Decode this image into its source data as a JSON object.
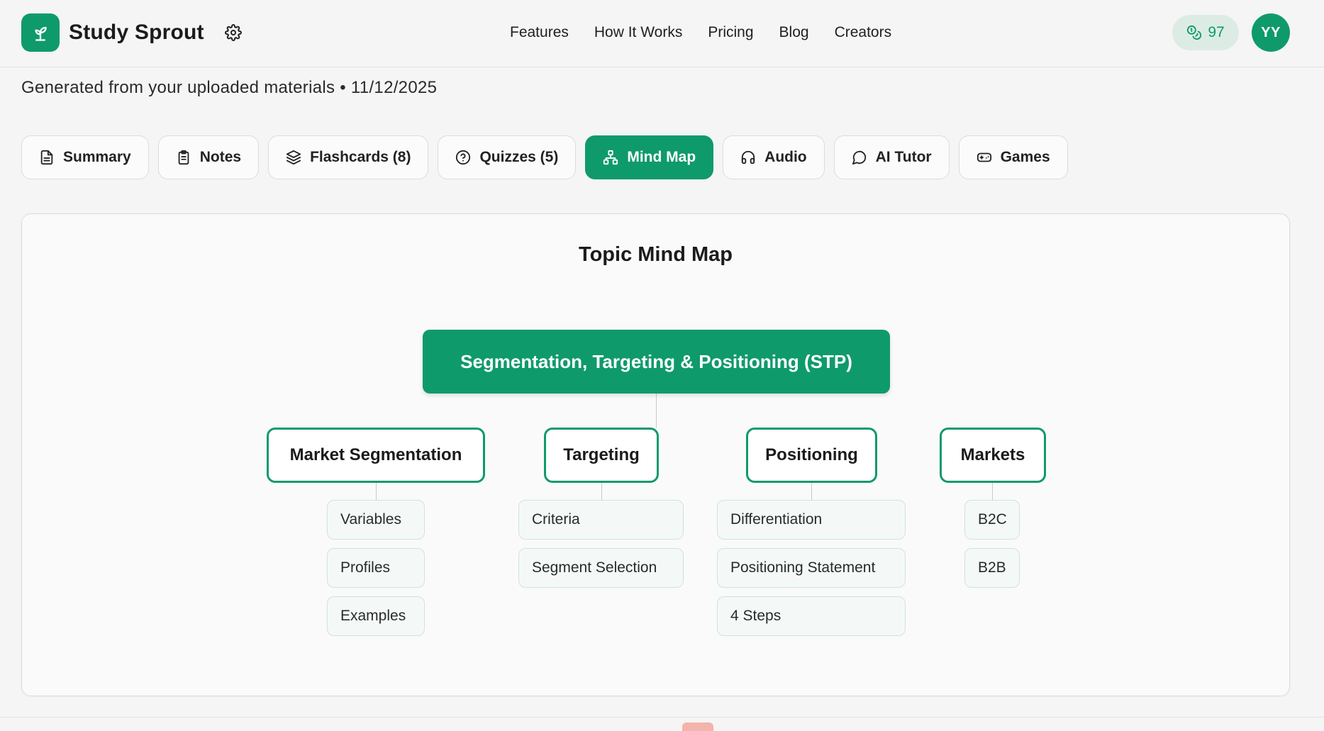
{
  "header": {
    "brand_name": "Study Sprout",
    "logo_icon": "sprout-icon",
    "nav": [
      "Features",
      "How It Works",
      "Pricing",
      "Blog",
      "Creators"
    ],
    "credits": "97",
    "avatar_initials": "YY"
  },
  "subtitle": "Generated from your uploaded materials • 11/12/2025",
  "tabs": [
    {
      "label": "Summary",
      "icon": "document-icon",
      "active": false
    },
    {
      "label": "Notes",
      "icon": "clipboard-icon",
      "active": false
    },
    {
      "label": "Flashcards (8)",
      "icon": "layers-icon",
      "active": false
    },
    {
      "label": "Quizzes (5)",
      "icon": "help-circle-icon",
      "active": false
    },
    {
      "label": "Mind Map",
      "icon": "network-icon",
      "active": true
    },
    {
      "label": "Audio",
      "icon": "headphones-icon",
      "active": false
    },
    {
      "label": "AI Tutor",
      "icon": "chat-bubble-icon",
      "active": false
    },
    {
      "label": "Games",
      "icon": "gamepad-icon",
      "active": false
    }
  ],
  "mindmap": {
    "title": "Topic Mind Map",
    "root": "Segmentation, Targeting & Positioning (STP)",
    "branches": [
      {
        "label": "Market Segmentation",
        "children": [
          "Variables",
          "Profiles",
          "Examples"
        ]
      },
      {
        "label": "Targeting",
        "children": [
          "Criteria",
          "Segment Selection"
        ]
      },
      {
        "label": "Positioning",
        "children": [
          "Differentiation",
          "Positioning Statement",
          "4 Steps"
        ]
      },
      {
        "label": "Markets",
        "children": [
          "B2C",
          "B2B"
        ]
      }
    ]
  },
  "colors": {
    "accent": "#0f9a6b",
    "accent_light": "#dcece5",
    "background": "#f5f5f5",
    "card": "#fafafa",
    "leaf_bg": "#f4f9f7"
  }
}
